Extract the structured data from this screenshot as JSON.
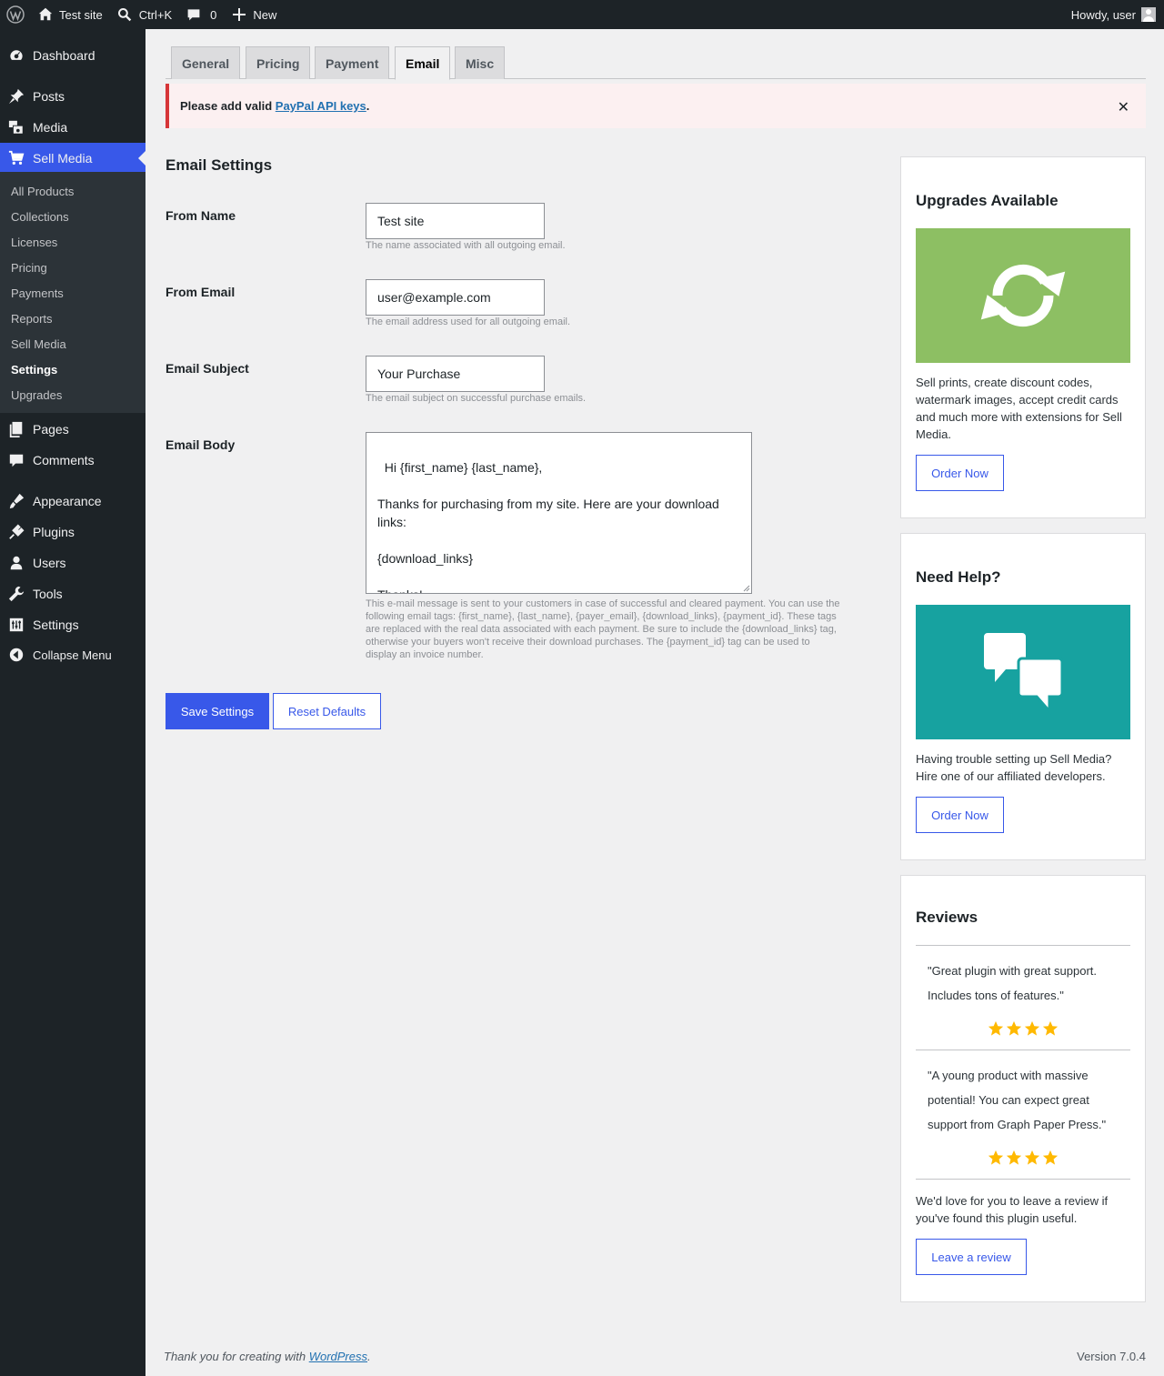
{
  "adminbar": {
    "site_name": "Test site",
    "search_shortcut": "Ctrl+K",
    "comments_count": "0",
    "new_label": "New",
    "greeting": "Howdy, user"
  },
  "sidebar": {
    "items": [
      {
        "label": "Dashboard",
        "icon": "dashboard-icon"
      },
      {
        "label": "Posts",
        "icon": "pushpin-icon"
      },
      {
        "label": "Media",
        "icon": "media-icon"
      },
      {
        "label": "Sell Media",
        "icon": "cart-icon"
      },
      {
        "label": "Pages",
        "icon": "pages-icon"
      },
      {
        "label": "Comments",
        "icon": "comment-icon"
      },
      {
        "label": "Appearance",
        "icon": "brush-icon"
      },
      {
        "label": "Plugins",
        "icon": "plug-icon"
      },
      {
        "label": "Users",
        "icon": "user-icon"
      },
      {
        "label": "Tools",
        "icon": "wrench-icon"
      },
      {
        "label": "Settings",
        "icon": "sliders-icon"
      },
      {
        "label": "Collapse Menu",
        "icon": "collapse-icon"
      }
    ],
    "submenu": [
      "All Products",
      "Collections",
      "Licenses",
      "Pricing",
      "Payments",
      "Reports",
      "Sell Media",
      "Settings",
      "Upgrades"
    ]
  },
  "tabs": [
    "General",
    "Pricing",
    "Payment",
    "Email",
    "Misc"
  ],
  "notice": {
    "prefix": "Please add valid ",
    "link": "PayPal API keys",
    "suffix": ".",
    "dismiss": "✕"
  },
  "form": {
    "heading": "Email Settings",
    "from_name": {
      "label": "From Name",
      "value": "Test site",
      "desc": "The name associated with all outgoing email."
    },
    "from_email": {
      "label": "From Email",
      "value": "user@example.com",
      "desc": "The email address used for all outgoing email."
    },
    "subject": {
      "label": "Email Subject",
      "value": "Your Purchase",
      "desc": "The email subject on successful purchase emails."
    },
    "body": {
      "label": "Email Body",
      "value": "Hi {first_name} {last_name},\n\nThanks for purchasing from my site. Here are your download links:\n\n{download_links}\n\nThanks!",
      "desc": "This e-mail message is sent to your customers in case of successful and cleared payment. You can use the following email tags: {first_name}, {last_name}, {payer_email}, {download_links}, {payment_id}. These tags are replaced with the real data associated with each payment. Be sure to include the {download_links} tag, otherwise your buyers won't receive their download purchases. The {payment_id} tag can be used to display an invoice number."
    },
    "save_label": "Save Settings",
    "reset_label": "Reset Defaults"
  },
  "widgets": {
    "upgrades": {
      "title": "Upgrades Available",
      "text": "Sell prints, create discount codes, watermark images, accept credit cards and much more with extensions for Sell Media.",
      "button": "Order Now",
      "color": "#8dbf63"
    },
    "help": {
      "title": "Need Help?",
      "text": "Having trouble setting up Sell Media? Hire one of our affiliated developers.",
      "button": "Order Now",
      "color": "#17a2a0"
    },
    "reviews": {
      "title": "Reviews",
      "quotes": [
        {
          "text": "\"Great plugin with great support. Includes tons of features.\"",
          "stars": 4
        },
        {
          "text": "\"A young product with massive potential! You can expect great support from Graph Paper Press.\"",
          "stars": 4
        }
      ],
      "text": "We'd love for you to leave a review if you've found this plugin useful.",
      "button": "Leave a review",
      "star_color": "#ffb900"
    }
  },
  "footer": {
    "prefix": "Thank you for creating with ",
    "link": "WordPress",
    "suffix": ".",
    "version": "Version 7.0.4"
  },
  "colors": {
    "accent": "#3858e9",
    "error": "#d63638",
    "adminbar": "#1d2327"
  }
}
